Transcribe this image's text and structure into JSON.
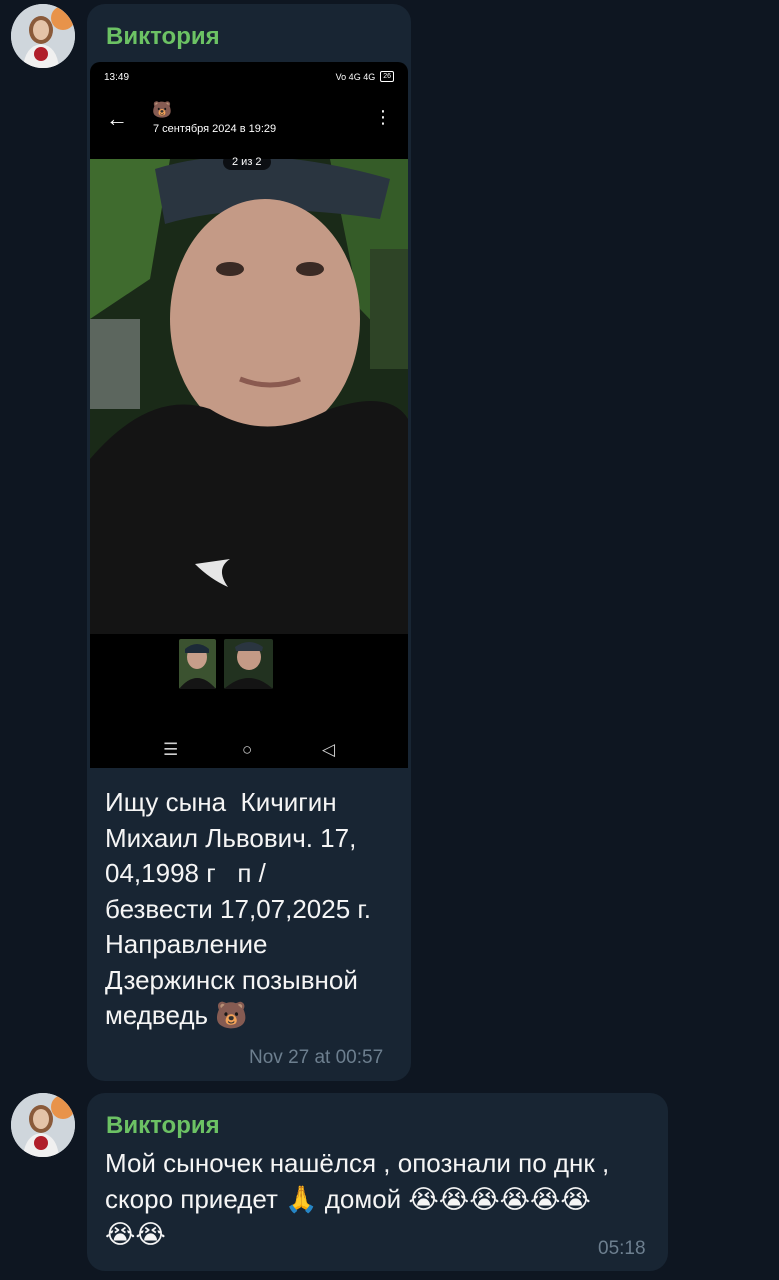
{
  "messages": [
    {
      "sender": "Виктория",
      "attachment": {
        "status_time": "13:49",
        "status_right": "Vo 4G 4G",
        "battery": "26",
        "top_emoji": "🐻",
        "date_line": "7 сентября 2024 в 19:29",
        "counter": "2 из 2",
        "back_icon": "←",
        "menu_icon": "⋮",
        "nav_icons": [
          "☰",
          "○",
          "◁"
        ]
      },
      "text": "Ищу сына  Кичигин\nМихаил Львович. 17,\n04,1998 г   п /\nбезвести 17,07,2025 г.\nНаправление\nДзержинск позывной\nмедведь 🐻",
      "time": "Nov 27 at 00:57"
    },
    {
      "sender": "Виктория",
      "text": "Мой сыночек нашёлся , опознали по днк ,\nскоро приедет 🙏 домой 😭😭😭😭😭😭\n😭😭",
      "time": "05:18"
    }
  ],
  "colors": {
    "background": "#0e1621",
    "bubble": "#182533",
    "sender_name": "#6cc264",
    "timestamp": "#6d7f8f"
  }
}
